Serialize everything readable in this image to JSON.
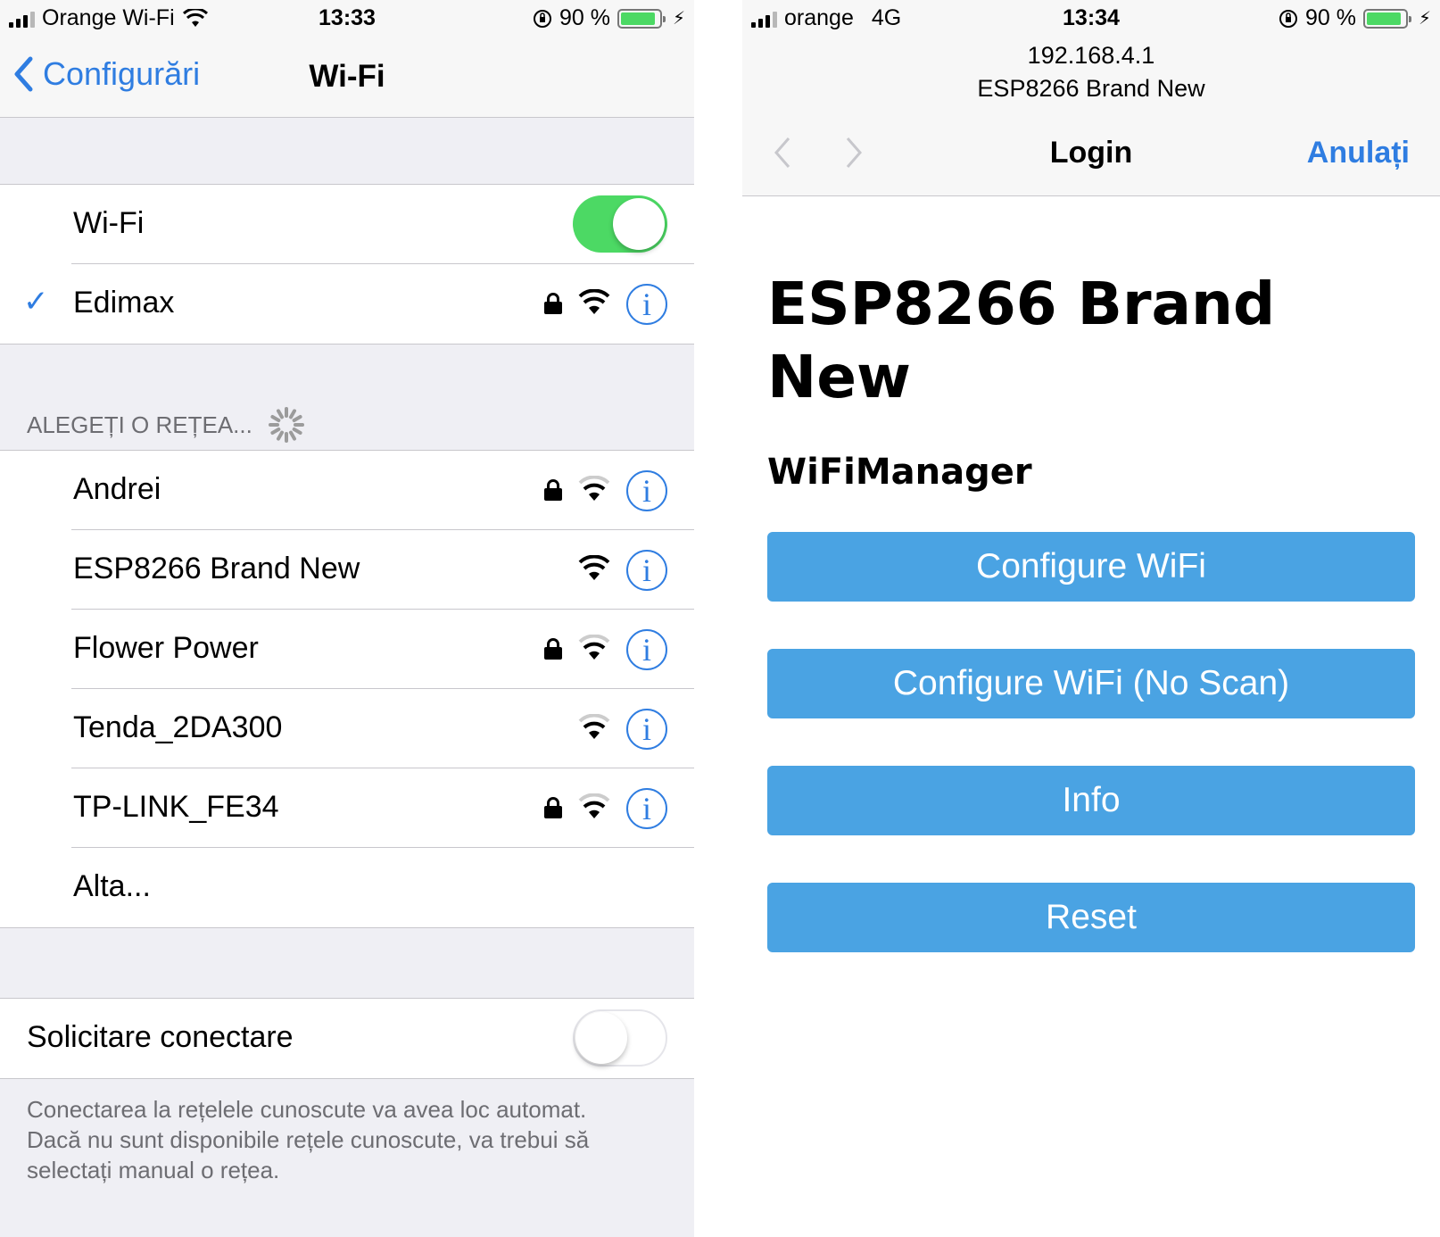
{
  "left": {
    "status": {
      "carrier": "Orange Wi-Fi",
      "time": "13:33",
      "battery": "90 %"
    },
    "nav": {
      "back_label": "Configurări",
      "title": "Wi-Fi"
    },
    "wifi_toggle": {
      "label": "Wi-Fi",
      "on": true
    },
    "connected": {
      "name": "Edimax",
      "secured": true
    },
    "section_header": "ALEGEȚI O REȚEA...",
    "networks": [
      {
        "name": "Andrei",
        "secured": true
      },
      {
        "name": "ESP8266 Brand New",
        "secured": false
      },
      {
        "name": "Flower Power",
        "secured": true
      },
      {
        "name": "Tenda_2DA300",
        "secured": false
      },
      {
        "name": "TP-LINK_FE34",
        "secured": true
      }
    ],
    "other_label": "Alta...",
    "ask_join": {
      "label": "Solicitare conectare",
      "on": false
    },
    "footer": "Conectarea la rețelele cunoscute va avea loc automat. Dacă nu sunt disponibile rețele cunoscute, va trebui să selectați manual o rețea."
  },
  "right": {
    "status": {
      "carrier": "orange",
      "network": "4G",
      "time": "13:34",
      "battery": "90 %"
    },
    "address": {
      "ip": "192.168.4.1",
      "ssid": "ESP8266 Brand New"
    },
    "nav": {
      "title": "Login",
      "cancel_label": "Anulați"
    },
    "page": {
      "title": "ESP8266 Brand New",
      "subtitle": "WiFiManager",
      "buttons": [
        "Configure WiFi",
        "Configure WiFi (No Scan)",
        "Info",
        "Reset"
      ]
    }
  },
  "colors": {
    "accent": "#2f7de1",
    "toggle_on": "#4cd964",
    "button": "#4aa3e3",
    "background": "#efeff4"
  },
  "icons": [
    "signal-bars-icon",
    "wifi-status-icon",
    "orientation-lock-icon",
    "battery-icon",
    "charging-icon",
    "chevron-left-icon",
    "checkmark-icon",
    "lock-icon",
    "wifi-signal-icon",
    "info-icon",
    "spinner-icon",
    "forward-arrow-icon"
  ]
}
